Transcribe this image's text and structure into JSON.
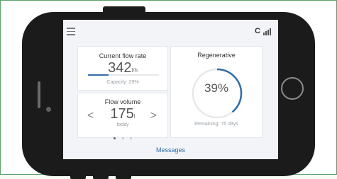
{
  "header": {
    "c_label": "C"
  },
  "flow": {
    "title": "Current flow rate",
    "value": "342",
    "unit": "l/h",
    "capacity_text": "Capacity: 29%",
    "capacity_fraction": 0.29
  },
  "volume": {
    "title": "Flow volume",
    "value": "175",
    "unit": "l",
    "period": "today",
    "prev": "<",
    "next": ">"
  },
  "regen": {
    "title": "Regenerative",
    "percent": "39%",
    "fraction": 0.39,
    "remaining": "Remaining: 75 days"
  },
  "footer": {
    "messages": "Messages"
  },
  "colors": {
    "accent": "#2f6ea8",
    "ring_track": "#e6e8ec",
    "phone": "#1b1b1b"
  },
  "icons": [
    "menu-icon",
    "signal-icon",
    "chevron-left-icon",
    "chevron-right-icon"
  ]
}
